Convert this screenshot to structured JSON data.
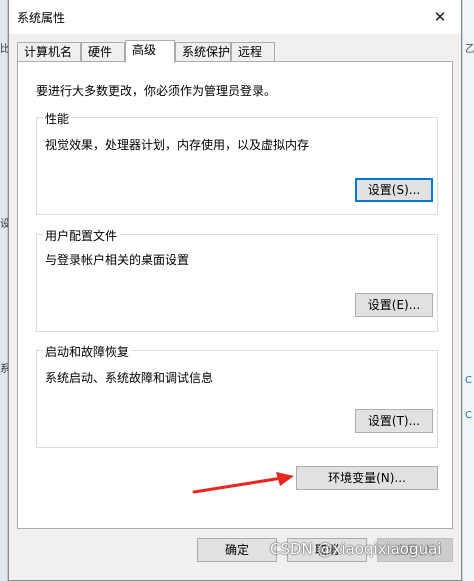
{
  "window": {
    "title": "系统属性",
    "close_icon": "close-icon"
  },
  "tabs": [
    {
      "label": "计算机名",
      "active": false
    },
    {
      "label": "硬件",
      "active": false
    },
    {
      "label": "高级",
      "active": true
    },
    {
      "label": "系统保护",
      "active": false
    },
    {
      "label": "远程",
      "active": false
    }
  ],
  "panel": {
    "intro": "要进行大多数更改，你必须作为管理员登录。",
    "performance": {
      "title": "性能",
      "description": "视觉效果，处理器计划，内存使用，以及虚拟内存",
      "button": "设置(S)..."
    },
    "user_profiles": {
      "title": "用户配置文件",
      "description": "与登录帐户相关的桌面设置",
      "button": "设置(E)..."
    },
    "startup_recovery": {
      "title": "启动和故障恢复",
      "description": "系统启动、系统故障和调试信息",
      "button": "设置(T)..."
    },
    "env_button": "环境变量(N)..."
  },
  "footer": {
    "ok": "确定",
    "cancel": "取消",
    "apply": "应用(A)"
  },
  "annotation": {
    "arrow_color": "#e8281e"
  },
  "watermark": "CSDN @xiaoqixiaoguai",
  "colors": {
    "accent": "#0078d7",
    "dialog_bg": "#f0f0f0",
    "button_bg": "#e1e1e1"
  }
}
